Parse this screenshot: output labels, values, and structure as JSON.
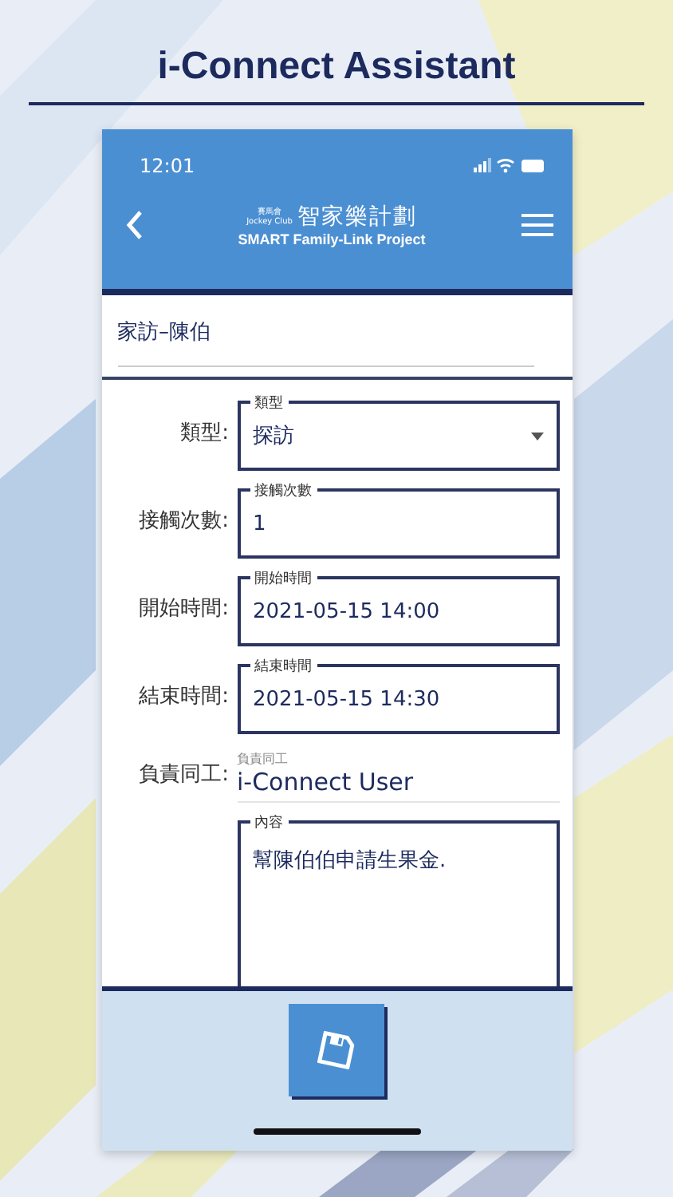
{
  "banner": {
    "title": "i-Connect Assistant"
  },
  "status_bar": {
    "time": "12:01"
  },
  "header": {
    "logo_chinese_small": "賽馬會",
    "logo_english_small": "Jockey Club",
    "logo_chinese": "智家樂計劃",
    "logo_english": "SMART Family-Link Project"
  },
  "record_title": "家訪–陳伯",
  "fields": [
    {
      "kind": "select",
      "label": "類型:",
      "legend": "類型",
      "value": "探訪"
    },
    {
      "kind": "input",
      "label": "接觸次數:",
      "legend": "接觸次數",
      "value": "1"
    },
    {
      "kind": "input",
      "label": "開始時間:",
      "legend": "開始時間",
      "value": "2021-05-15 14:00"
    },
    {
      "kind": "input",
      "label": "結束時間:",
      "legend": "結束時間",
      "value": "2021-05-15 14:30"
    },
    {
      "kind": "plain",
      "label": "負責同工:",
      "legend": "負責同工",
      "value": "i-Connect User"
    },
    {
      "kind": "textarea",
      "legend": "內容",
      "value": "幫陳伯伯申請生果金."
    }
  ]
}
